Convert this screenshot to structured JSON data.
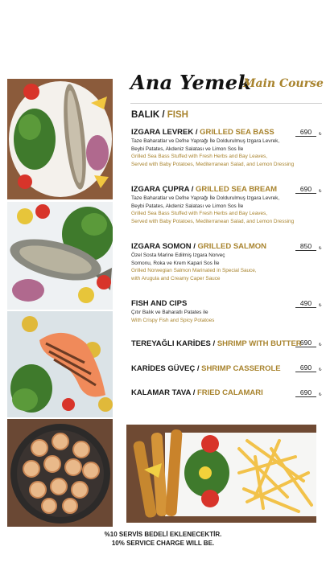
{
  "header": {
    "title_tr": "Ana Yemek",
    "title_en": "Main Course"
  },
  "section": {
    "title_tr": "BALIK / ",
    "title_en": "FISH"
  },
  "items": [
    {
      "name_tr": "IZGARA LEVREK / ",
      "name_en": "GRILLED SEA BASS",
      "desc_tr": [
        "Taze Baharatlar ve Defne Yaprağı İle Doldurulmuş Izgara Levrek,",
        "Beybi Patates, Akdeniz Salatası ve Limon Sos İle"
      ],
      "desc_en": [
        "Grilled Sea Bass Stuffed with Fresh Herbs and Bay Leaves,",
        "Served with Baby Potatoes, Mediterranean Salad, and Lemon Dressing"
      ],
      "price": "690",
      "currency": "₺"
    },
    {
      "name_tr": "IZGARA ÇUPRA / ",
      "name_en": "GRILLED SEA BREAM",
      "desc_tr": [
        "Taze Baharatlar ve Defne Yaprağı İle Doldurulmuş Izgara Levrek,",
        "Beybi Patates, Akdeniz Salatası ve Limon Sos İle"
      ],
      "desc_en": [
        "Grilled Sea Bass Stuffed with Fresh Herbs and Bay Leaves,",
        "Served with Baby Potatoes, Mediterranean Salad, and Lemon Dressing"
      ],
      "price": "690",
      "currency": "₺"
    },
    {
      "name_tr": "IZGARA SOMON / ",
      "name_en": "GRILLED SALMON",
      "desc_tr": [
        "Özel Sosta Marine Edilmiş Izgara Norveç",
        "Somonu, Roka ve Krem Kapari Sos İle"
      ],
      "desc_en": [
        "Grilled Norwegian Salmon Marinated in Special Sauce,",
        "with Arugula and Creamy Caper Sauce"
      ],
      "price": "850",
      "currency": "₺"
    },
    {
      "name_tr": "FISH AND CIPS",
      "name_en": "",
      "desc_tr": [
        "Çıtır Balık ve Baharatlı Patates ile"
      ],
      "desc_en": [
        "With Crispy Fish and Spicy Potatoes"
      ],
      "price": "490",
      "currency": "₺"
    },
    {
      "name_tr": "TEREYAĞLI KARİDES / ",
      "name_en": "SHRIMP WITH BUTTER",
      "price": "690",
      "currency": "₺"
    },
    {
      "name_tr": "KARİDES GÜVEÇ / ",
      "name_en": "SHRIMP CASSEROLE",
      "price": "690",
      "currency": "₺"
    },
    {
      "name_tr": "KALAMAR TAVA / ",
      "name_en": "FRIED CALAMARI",
      "price": "690",
      "currency": "₺"
    }
  ],
  "footer": {
    "line_tr": "%10 SERVİS BEDELİ EKLENECEKTİR.",
    "line_en": "10% SERVICE CHARGE WILL BE."
  },
  "colors": {
    "accent_gold": "#a8832d",
    "text_dark": "#1a1a1a"
  }
}
